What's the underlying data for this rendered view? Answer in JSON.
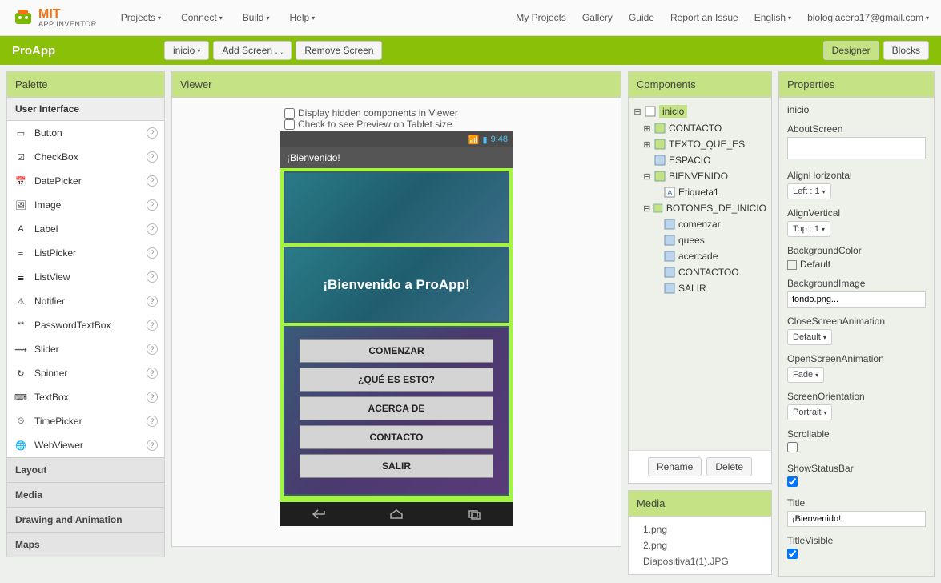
{
  "brand": {
    "mit": "MIT",
    "sub": "APP INVENTOR"
  },
  "topmenu": {
    "projects": "Projects",
    "connect": "Connect",
    "build": "Build",
    "help": "Help"
  },
  "toplinks": {
    "myprojects": "My Projects",
    "gallery": "Gallery",
    "guide": "Guide",
    "report": "Report an Issue",
    "english": "English",
    "email": "biologiacerp17@gmail.com"
  },
  "greenbar": {
    "project": "ProApp",
    "screen_sel": "inicio",
    "add": "Add Screen ...",
    "remove": "Remove Screen",
    "designer": "Designer",
    "blocks": "Blocks"
  },
  "palette": {
    "header": "Palette",
    "user_interface": "User Interface",
    "items": [
      {
        "label": "Button"
      },
      {
        "label": "CheckBox"
      },
      {
        "label": "DatePicker"
      },
      {
        "label": "Image"
      },
      {
        "label": "Label"
      },
      {
        "label": "ListPicker"
      },
      {
        "label": "ListView"
      },
      {
        "label": "Notifier"
      },
      {
        "label": "PasswordTextBox"
      },
      {
        "label": "Slider"
      },
      {
        "label": "Spinner"
      },
      {
        "label": "TextBox"
      },
      {
        "label": "TimePicker"
      },
      {
        "label": "WebViewer"
      }
    ],
    "cats": [
      "Layout",
      "Media",
      "Drawing and Animation",
      "Maps"
    ]
  },
  "viewer": {
    "header": "Viewer",
    "hidden": "Display hidden components in Viewer",
    "tablet": "Check to see Preview on Tablet size.",
    "time": "9:48",
    "titlebar": "¡Bienvenido!",
    "welcome": "¡Bienvenido a ProApp!",
    "buttons": [
      "COMENZAR",
      "¿QUÉ ES ESTO?",
      "ACERCA DE",
      "CONTACTO",
      "SALIR"
    ]
  },
  "components": {
    "header": "Components",
    "tree": {
      "root": "inicio",
      "contacto": "CONTACTO",
      "texto": "TEXTO_QUE_ES",
      "espacio": "ESPACIO",
      "bienvenido": "BIENVENIDO",
      "etiqueta": "Etiqueta1",
      "botones": "BOTONES_DE_INICIO",
      "comenzar": "comenzar",
      "quees": "quees",
      "acercade": "acercade",
      "contactoo": "CONTACTOO",
      "salir": "SALIR"
    },
    "rename": "Rename",
    "delete": "Delete"
  },
  "media": {
    "header": "Media",
    "items": [
      "1.png",
      "2.png",
      "Diapositiva1(1).JPG"
    ]
  },
  "properties": {
    "header": "Properties",
    "target": "inicio",
    "fields": {
      "about": "AboutScreen",
      "alignh": "AlignHorizontal",
      "alignh_v": "Left : 1",
      "alignv": "AlignVertical",
      "alignv_v": "Top : 1",
      "bgcolor": "BackgroundColor",
      "bgcolor_v": "Default",
      "bgimage": "BackgroundImage",
      "bgimage_v": "fondo.png...",
      "closeanim": "CloseScreenAnimation",
      "closeanim_v": "Default",
      "openanim": "OpenScreenAnimation",
      "openanim_v": "Fade",
      "orient": "ScreenOrientation",
      "orient_v": "Portrait",
      "scrollable": "Scrollable",
      "statusbar": "ShowStatusBar",
      "title": "Title",
      "title_v": "¡Bienvenido!",
      "titlevis": "TitleVisible"
    }
  }
}
